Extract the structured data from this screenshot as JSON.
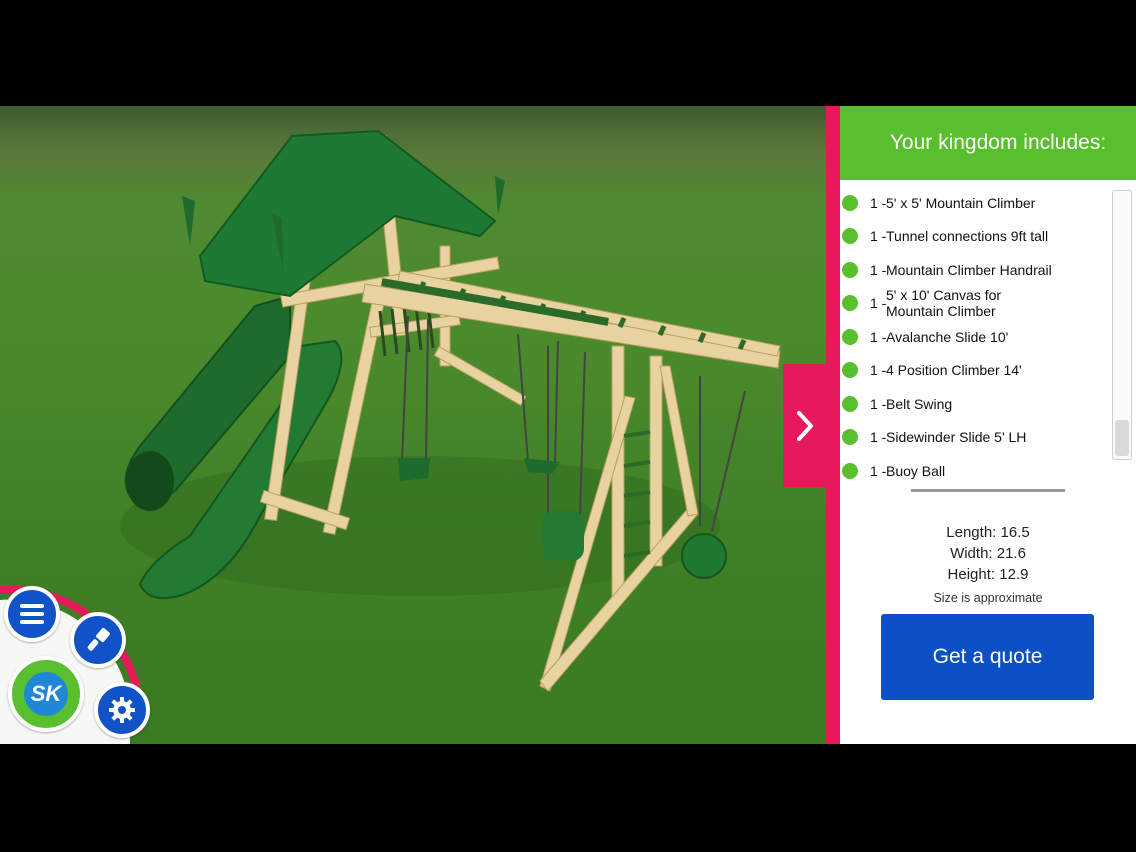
{
  "panel": {
    "title": "Your kingdom includes:",
    "items": [
      {
        "qty": "1 -",
        "name": "5' x 5' Mountain Climber"
      },
      {
        "qty": "1 -",
        "name": "Tunnel connections 9ft tall"
      },
      {
        "qty": "1 -",
        "name": "Mountain Climber Handrail"
      },
      {
        "qty": "1 -",
        "name": "5' x 10' Canvas for Mountain Climber"
      },
      {
        "qty": "1 -",
        "name": "Avalanche Slide 10'"
      },
      {
        "qty": "1 -",
        "name": "4 Position Climber 14'"
      },
      {
        "qty": "1 -",
        "name": "Belt Swing"
      },
      {
        "qty": "1 -",
        "name": "Sidewinder Slide 5' LH"
      },
      {
        "qty": "1 -",
        "name": "Buoy Ball"
      }
    ],
    "length": "Length: 16.5",
    "width": "Width: 21.6",
    "height": "Height: 12.9",
    "note": "Size is approximate",
    "quote_label": "Get a quote"
  },
  "toolbar": {
    "logo_text": "SK",
    "menu_icon": "hamburger-menu-icon",
    "paint_icon": "paint-brush-icon",
    "settings_icon": "gear-icon"
  },
  "colors": {
    "accent_pink": "#e6195a",
    "header_green": "#5abf2e",
    "button_blue": "#0d4fc4"
  }
}
